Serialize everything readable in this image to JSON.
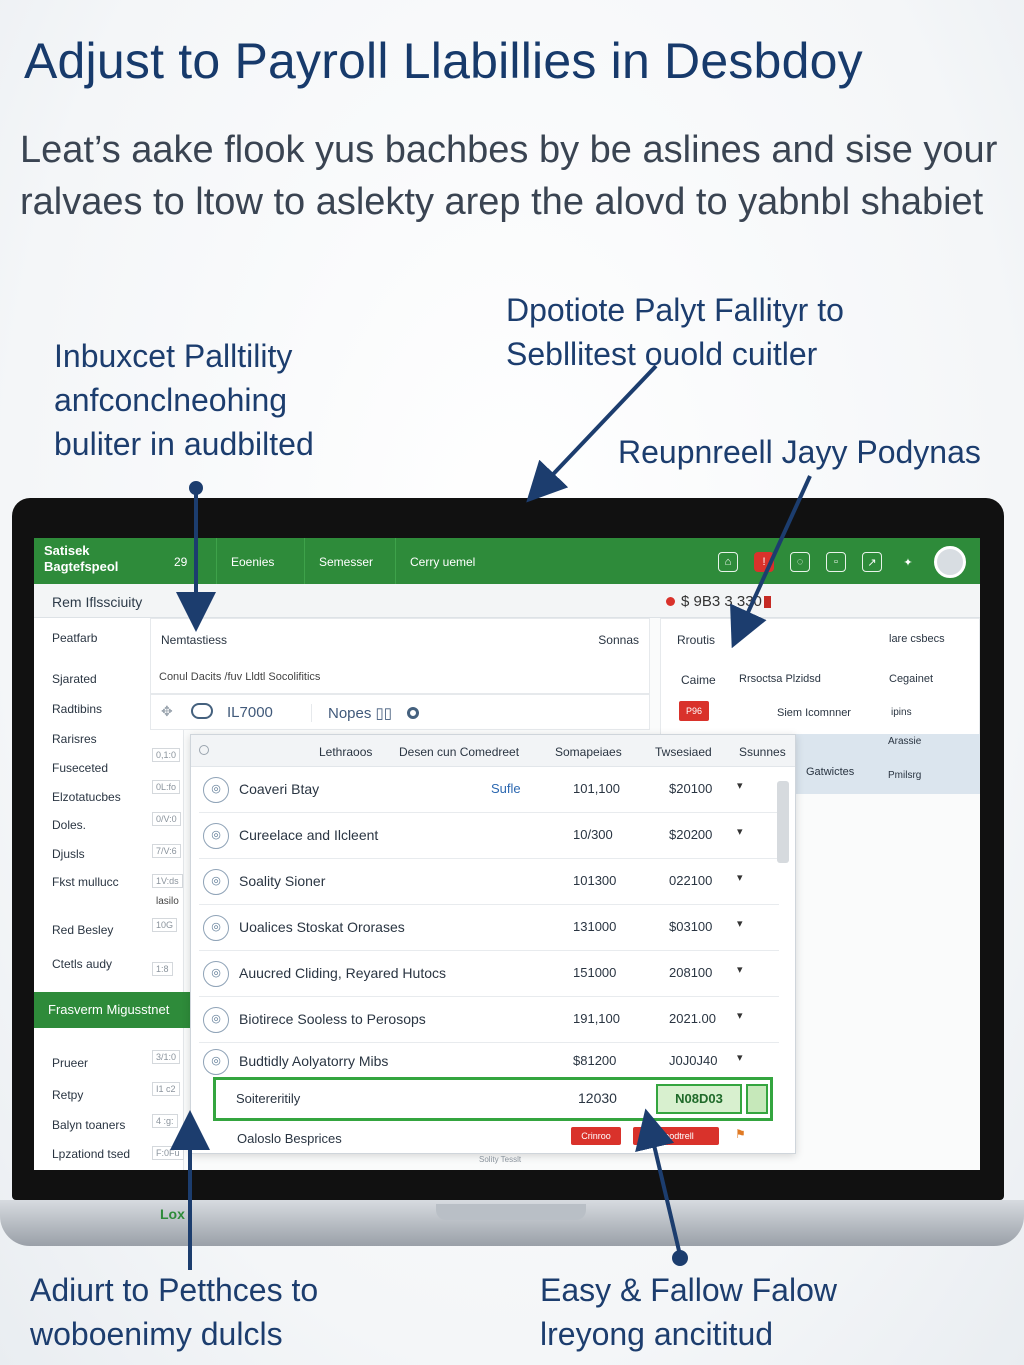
{
  "header": {
    "title": "Adjust to Payroll Llabillies in Desbdoy",
    "subtitle": "Leat’s aake flook yus bachbes by be aslines and sise your ralvaes to ltow to aslekty arep the alovd to yabnbl shabiet"
  },
  "callouts": {
    "left_top": [
      "Inbuxcet Palltility",
      "anfconclneohing",
      "buliter in audbilted"
    ],
    "center_top": [
      "Dpotiote Palyt Fallityr to",
      "Sebllitest ouold cuitler"
    ],
    "right": "Reupnreell Jayy Podynas",
    "bottom_left": [
      "Adiurt to Petthces to",
      "woboenimy dulcls"
    ],
    "bottom_right": [
      "Easy & Fallow Falow",
      "lreyong ancititud"
    ]
  },
  "app": {
    "brand_line1": "Satisek",
    "brand_line2": "Bagtefspeol",
    "tab_number": "29",
    "tabs": [
      "Eoenies",
      "Semesser",
      "Cerry uemel"
    ],
    "top_icons": [
      "home-icon",
      "alert-icon",
      "chat-icon",
      "grid-icon",
      "export-icon",
      "pin-icon"
    ],
    "subbar_label": "Rem Iflssciuity",
    "amount": "$ 9B3 3 330"
  },
  "sidebar": {
    "items": [
      "Peatfarb",
      "Sjarated",
      "Radtibins",
      "Rarisres",
      "Fuseceted",
      "Elzotatucbes",
      "Doles.",
      "Djusls",
      "Fkst mullucc",
      "Red Besley",
      "Ctetls audy"
    ],
    "mini_values": [
      "0,1:0",
      "0L:fo",
      "0/V:0",
      "7/V:6",
      "1V:ds",
      "10G",
      "1:8"
    ],
    "mini_label": "lasilo",
    "green_section": "Frasverm Migusstnet",
    "bottom_items": [
      "Prueer",
      "Retpy",
      "Balyn toaners",
      "Lpzationd tsed"
    ],
    "bottom_minis": [
      "3/1:0",
      "I1 c2",
      "4 :g:",
      "F:0Fu"
    ]
  },
  "panel": {
    "head_left": "Nemtastiess",
    "head_right": "Sonnas",
    "head_line": "Conul Dacits /fuv Lldtl Socolifitics",
    "code": "IL7000",
    "notes": "Nopes ▯▯"
  },
  "right_panel": {
    "col1": "Rroutis",
    "col2": "lare csbecs",
    "r1a": "Caime",
    "r1b": "Rrsoctsa Plzidsd",
    "r1c": "Cegainet",
    "badge": "P96",
    "r2b": "Siem Icomnner",
    "r2c": "ipins",
    "blue_a": "Gatwictes",
    "blue_b": "Arassie",
    "blue_c": "Pmilsrg"
  },
  "table": {
    "headers": [
      "Lethraoos",
      "Desen cun Comedreet",
      "Somapeiaes",
      "Twsesiaed",
      "Ssunnes"
    ],
    "rows": [
      {
        "name": "Coaveri Btay",
        "link": "Sufle",
        "v1": "101,100",
        "v2": "$20100"
      },
      {
        "name": "Cureelace and Ilcleent",
        "link": "",
        "v1": "10/300",
        "v2": "$20200"
      },
      {
        "name": "Soality Sioner",
        "link": "",
        "v1": "101300",
        "v2": "022100"
      },
      {
        "name": "Uoalices Stoskat Ororases",
        "link": "",
        "v1": "131000",
        "v2": "$03100"
      },
      {
        "name": "Auucred Cliding, Reyared Hutocs",
        "link": "",
        "v1": "151000",
        "v2": "208100"
      },
      {
        "name": "Biotirece Sooless to Perosops",
        "link": "",
        "v1": "191,100",
        "v2": "2021.00"
      },
      {
        "name": "Budtidly Aolyatorry Mibs",
        "link": "",
        "v1": "$81200",
        "v2": "J0J0J40"
      }
    ],
    "highlight": {
      "name": "Soitereritily",
      "value": "12030",
      "box": "N08D03"
    },
    "last_row": "Oaloslo Besprices",
    "buttons": [
      "Crinroo",
      "Beodtrell"
    ],
    "footer": "Solity Tesslt"
  },
  "bottom_label": "Lox"
}
